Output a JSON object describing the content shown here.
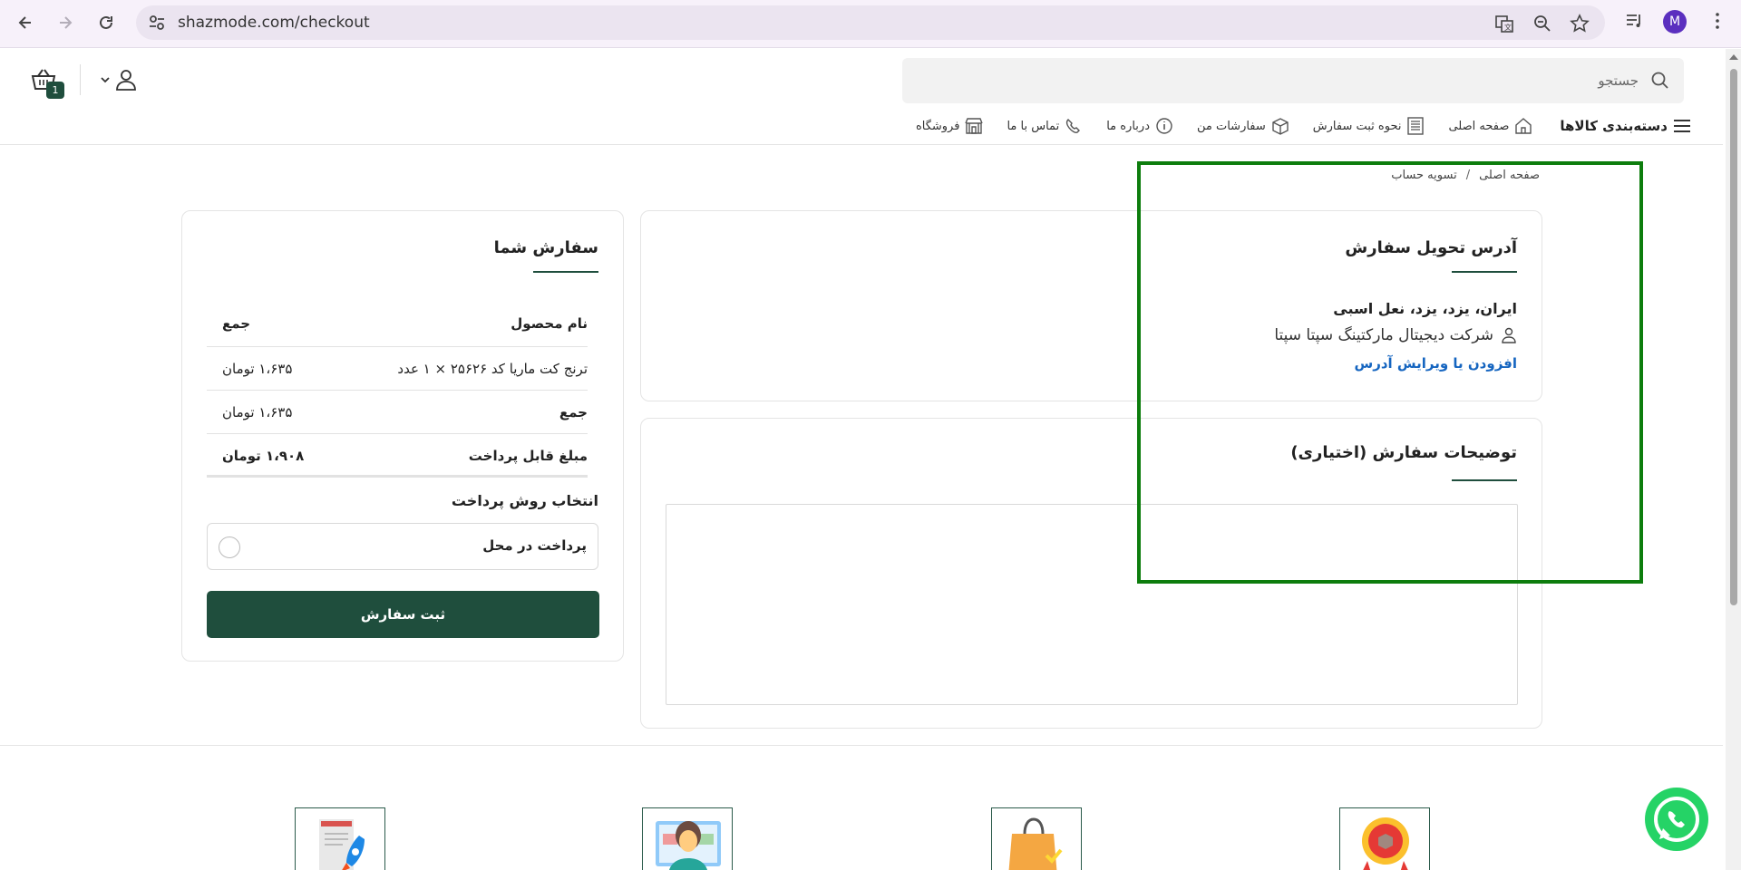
{
  "browser": {
    "url": "shazmode.com/checkout",
    "profile_initial": "M",
    "icons": [
      "back-arrow-icon",
      "forward-arrow-icon",
      "reload-icon",
      "site-settings-icon",
      "translate-icon",
      "zoom-icon",
      "bookmark-star-icon",
      "media-controls-icon",
      "kebab-menu-icon"
    ]
  },
  "header": {
    "search_placeholder": "جستجو",
    "cart_count": "1",
    "nav": [
      {
        "label": "دسته‌بندی کالاها",
        "icon": "hamburger-menu-icon"
      },
      {
        "label": "صفحه اصلی",
        "icon": "home-icon"
      },
      {
        "label": "نحوه ثبت سفارش",
        "icon": "list-document-icon"
      },
      {
        "label": "سفارشات من",
        "icon": "package-box-icon"
      },
      {
        "label": "درباره ما",
        "icon": "info-bubble-icon"
      },
      {
        "label": "تماس با ما",
        "icon": "phone-contact-icon"
      },
      {
        "label": "فروشگاه",
        "icon": "store-icon"
      }
    ]
  },
  "breadcrumb": {
    "home": "صفحه اصلی",
    "separator": "/",
    "current": "تسویه حساب"
  },
  "address": {
    "title": "آدرس تحویل سفارش",
    "line": "ایران، یزد، یزد، نعل اسبی",
    "recipient": "شرکت دیجیتال مارکتینگ سپتا سپتا",
    "edit_link": "افزودن یا ویرایش آدرس"
  },
  "notes": {
    "title": "توضیحات سفارش (اختیاری)",
    "value": ""
  },
  "order": {
    "title": "سفارش شما",
    "head": {
      "product": "نام محصول",
      "sum": "جمع"
    },
    "items": [
      {
        "name": "ترنج کت ماریا کد ۲۵۶۲۶ × ۱ عدد",
        "price": "۱،۶۳۵ تومان"
      }
    ],
    "subtotal": {
      "label": "جمع",
      "value": "۱،۶۳۵ تومان"
    },
    "total": {
      "label": "مبلغ قابل پرداخت",
      "value": "۱،۹۰۸ تومان"
    },
    "payment_title": "انتخاب روش پرداخت",
    "payment_option": "پرداخت در محل",
    "submit": "ثبت سفارش"
  },
  "colors": {
    "brand": "#1f4e3d",
    "link": "#1565c0",
    "highlight": "#0d7d0d",
    "whatsapp": "#25d366"
  }
}
